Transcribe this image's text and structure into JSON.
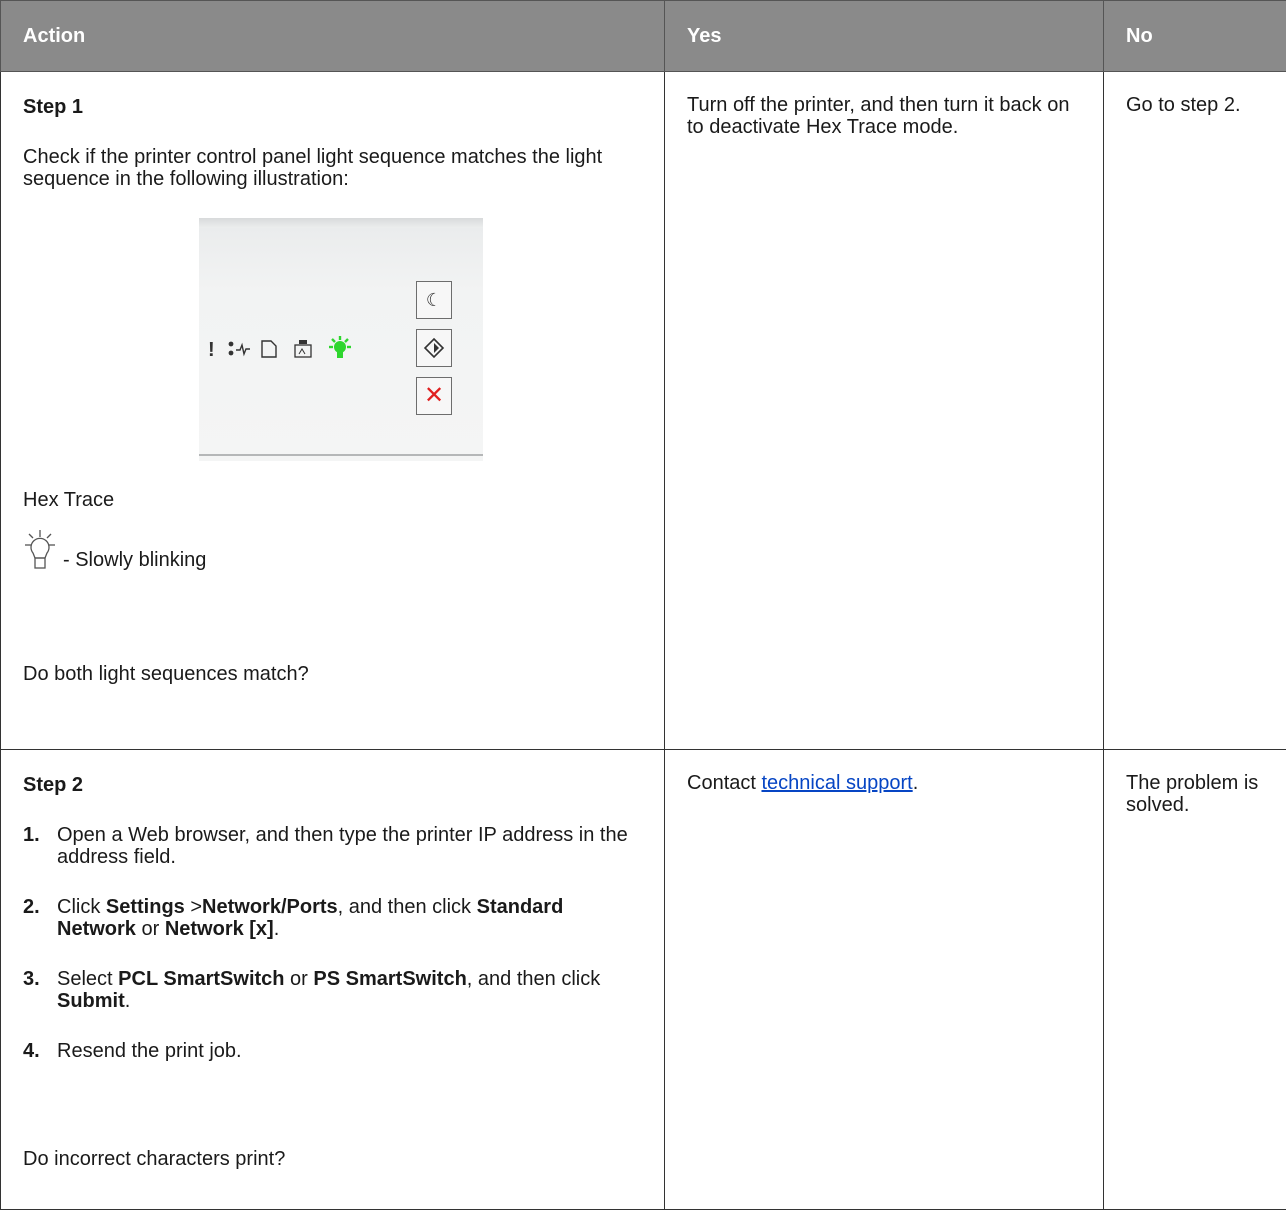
{
  "headers": {
    "action": "Action",
    "yes": "Yes",
    "no": "No"
  },
  "colors": {
    "header_bg": "#8a8a8a",
    "header_text": "#ffffff",
    "link": "#0645c4",
    "led_green": "#2ed62e",
    "cancel_red": "#e02020"
  },
  "row1": {
    "step": "Step 1",
    "instruction": "Check if the printer control panel light sequence matches the light sequence in the following illustration:",
    "illustration": {
      "lights": [
        "error-light",
        "toner-light",
        "paper-light",
        "drum-light",
        "ready-light"
      ],
      "ready_light_color": "#2ed62e",
      "buttons": [
        "sleep-button",
        "start-button",
        "stop-button"
      ]
    },
    "caption": "Hex Trace",
    "legend": "- Slowly blinking",
    "question": "Do both light sequences match?",
    "yes": "Turn off the printer, and then turn it back on to deactivate Hex Trace mode.",
    "no": "Go to step 2."
  },
  "row2": {
    "step": "Step 2",
    "items": [
      {
        "num": "1.",
        "text": "Open a Web browser, and then type the printer IP address in the address field."
      },
      {
        "num": "2.",
        "t1": "Click ",
        "b1": "Settings",
        "t2": " >",
        "b2": "Network/Ports",
        "t3": ", and then click ",
        "b3": "Standard Network",
        "t4": " or ",
        "b4": "Network [x]",
        "t5": "."
      },
      {
        "num": "3.",
        "t1": "Select ",
        "b1": "PCL SmartSwitch",
        "t2": " or ",
        "b2": "PS SmartSwitch",
        "t3": ", and then click ",
        "b3": "Submit",
        "t4": "."
      },
      {
        "num": "4.",
        "text": "Resend the print job."
      }
    ],
    "question": "Do incorrect characters print?",
    "yes_prefix": "Contact ",
    "yes_link": "technical support",
    "yes_suffix": ".",
    "no": "The problem is solved."
  }
}
